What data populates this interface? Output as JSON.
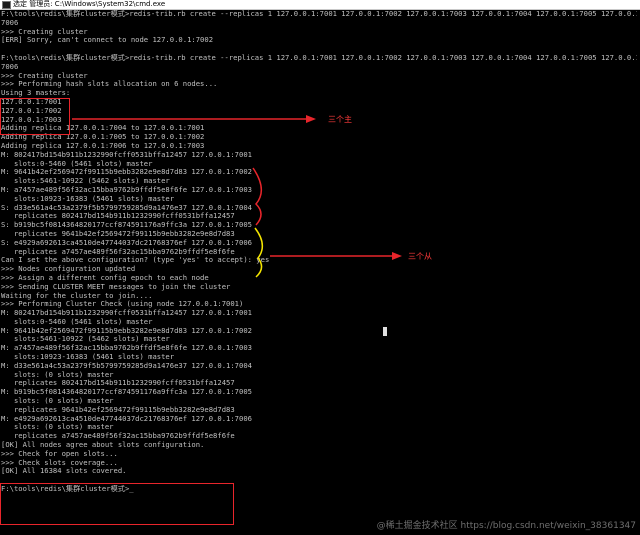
{
  "window": {
    "title": "选定 管理员: C:\\Windows\\System32\\cmd.exe"
  },
  "console": {
    "lines": [
      "F:\\tools\\redis\\集群cluster模式>redis-trib.rb create --replicas 1 127.0.0.1:7001 127.0.0.1:7002 127.0.0.1:7003 127.0.0.1:7004 127.0.0.1:7005 127.0.0.1:",
      "7006",
      ">>> Creating cluster",
      "[ERR] Sorry, can't connect to node 127.0.0.1:7002",
      "",
      "F:\\tools\\redis\\集群cluster模式>redis-trib.rb create --replicas 1 127.0.0.1:7001 127.0.0.1:7002 127.0.0.1:7003 127.0.0.1:7004 127.0.0.1:7005 127.0.0.1:",
      "7006",
      ">>> Creating cluster",
      ">>> Performing hash slots allocation on 6 nodes...",
      "Using 3 masters:",
      "127.0.0.1:7001",
      "127.0.0.1:7002",
      "127.0.0.1:7003",
      "Adding replica 127.0.0.1:7004 to 127.0.0.1:7001",
      "Adding replica 127.0.0.1:7005 to 127.0.0.1:7002",
      "Adding replica 127.0.0.1:7006 to 127.0.0.1:7003",
      "M: 802417bd154b911b1232990fcff0531bffa12457 127.0.0.1:7001",
      "   slots:0-5460 (5461 slots) master",
      "M: 9641b42ef2569472f99115b9ebb3282e9e8d7d83 127.0.0.1:7002",
      "   slots:5461-10922 (5462 slots) master",
      "M: a7457ae489f56f32ac15bba9762b9ffdf5e8f6fe 127.0.0.1:7003",
      "   slots:10923-16383 (5461 slots) master",
      "S: d33e561a4c53a2379f5b5799759285d9a1476e37 127.0.0.1:7004",
      "   replicates 802417bd154b911b1232990fcff0531bffa12457",
      "S: b919bc5f0814364820177ccf874591176a9ffc3a 127.0.0.1:7005",
      "   replicates 9641b42ef2569472f99115b9ebb3282e9e8d7d83",
      "S: e4929a692613ca4510de47744037dc21768376ef 127.0.0.1:7006",
      "   replicates a7457ae489f56f32ac15bba9762b9ffdf5e8f6fe",
      "Can I set the above configuration? (type 'yes' to accept): yes",
      ">>> Nodes configuration updated",
      ">>> Assign a different config epoch to each node",
      ">>> Sending CLUSTER MEET messages to join the cluster",
      "Waiting for the cluster to join....",
      ">>> Performing Cluster Check (using node 127.0.0.1:7001)",
      "M: 802417bd154b911b1232990fcff0531bffa12457 127.0.0.1:7001",
      "   slots:0-5460 (5461 slots) master",
      "M: 9641b42ef2569472f99115b9ebb3282e9e8d7d83 127.0.0.1:7002",
      "   slots:5461-10922 (5462 slots) master",
      "M: a7457ae489f56f32ac15bba9762b9ffdf5e8f6fe 127.0.0.1:7003",
      "   slots:10923-16383 (5461 slots) master",
      "M: d33e561a4c53a2379f5b5799759285d9a1476e37 127.0.0.1:7004",
      "   slots: (0 slots) master",
      "   replicates 802417bd154b911b1232990fcff0531bffa12457",
      "M: b919bc5f0814364820177ccf874591176a9ffc3a 127.0.0.1:7005",
      "   slots: (0 slots) master",
      "   replicates 9641b42ef2569472f99115b9ebb3282e9e8d7d83",
      "M: e4929a692613ca4510de47744037dc21768376ef 127.0.0.1:7006",
      "   slots: (0 slots) master",
      "   replicates a7457ae489f56f32ac15bba9762b9ffdf5e8f6fe",
      "[OK] All nodes agree about slots configuration.",
      ">>> Check for open slots...",
      ">>> Check slots coverage...",
      "[OK] All 16384 slots covered.",
      "",
      "F:\\tools\\redis\\集群cluster模式>_"
    ]
  },
  "annotations": {
    "three_masters": "三个主",
    "three_slaves": "三个从",
    "box_color": "#e8252b",
    "brace_red_color": "#e8252b",
    "brace_yellow_color": "#f4e500"
  },
  "watermark": "@稀土掘金技术社区 https://blog.csdn.net/weixin_38361347"
}
